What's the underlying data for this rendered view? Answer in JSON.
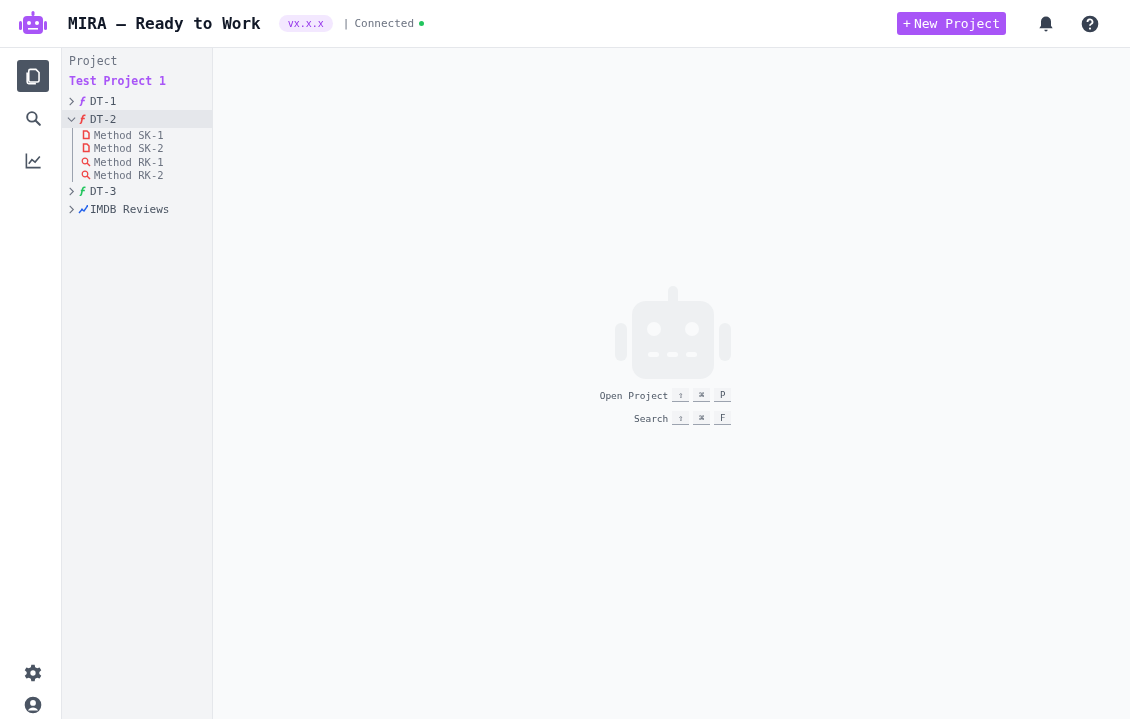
{
  "header": {
    "title": "MIRA – Ready to Work",
    "version": "vx.x.x",
    "separator": "|",
    "status": "Connected",
    "connected": true,
    "new_button": {
      "icon": "+",
      "label": "New Project"
    }
  },
  "rail": {
    "items": [
      {
        "kind": "files",
        "selected": true
      },
      {
        "kind": "search",
        "selected": false
      },
      {
        "kind": "chart",
        "selected": false
      }
    ],
    "bottom": [
      {
        "kind": "settings"
      },
      {
        "kind": "user"
      }
    ]
  },
  "sidebar": {
    "heading": "Project",
    "project": "Test Project 1",
    "tree": [
      {
        "label": "DT-1",
        "kind": "function",
        "color": "#a855f7",
        "expanded": false,
        "selected": false
      },
      {
        "label": "DT-2",
        "kind": "function",
        "color": "#ef4444",
        "expanded": true,
        "selected": true,
        "children": [
          {
            "label": "Method SK-1",
            "kind": "document",
            "color": "#ef4444"
          },
          {
            "label": "Method SK-2",
            "kind": "document",
            "color": "#ef4444"
          },
          {
            "label": "Method RK-1",
            "kind": "search",
            "color": "#ef4444"
          },
          {
            "label": "Method RK-2",
            "kind": "search",
            "color": "#ef4444"
          }
        ]
      },
      {
        "label": "DT-3",
        "kind": "function",
        "color": "#22c55e",
        "expanded": false,
        "selected": false
      },
      {
        "label": "IMDB Reviews",
        "kind": "chart",
        "color": "#2563eb",
        "expanded": false,
        "selected": false
      }
    ]
  },
  "empty_state": {
    "shortcuts": [
      {
        "label": "Open Project",
        "keys": [
          "⇧",
          "⌘",
          "P"
        ]
      },
      {
        "label": "Search",
        "keys": [
          "⇧",
          "⌘",
          "F"
        ]
      }
    ]
  }
}
